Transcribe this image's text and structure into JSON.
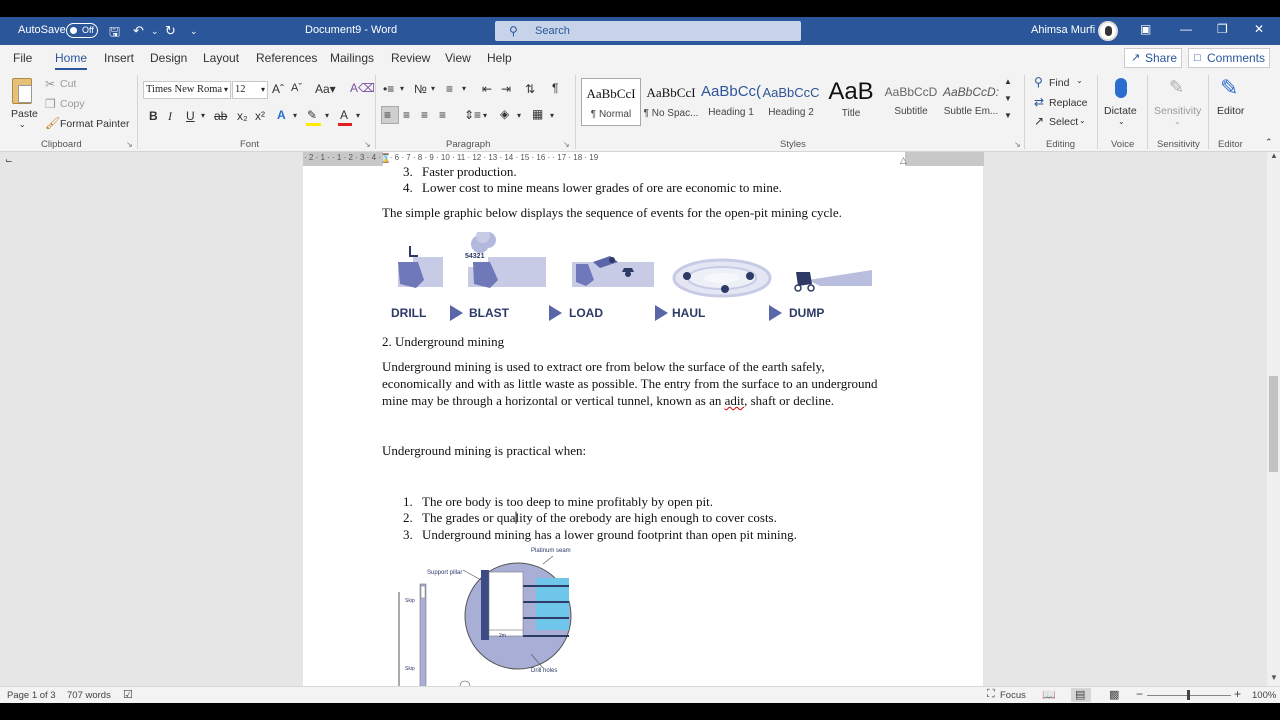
{
  "titlebar": {
    "autosave_label": "AutoSave",
    "autosave_state": "Off",
    "document_title": "Document9  -  Word",
    "search_placeholder": "Search",
    "user_name": "Ahimsa Murfi"
  },
  "tabs": [
    "File",
    "Home",
    "Insert",
    "Design",
    "Layout",
    "References",
    "Mailings",
    "Review",
    "View",
    "Help"
  ],
  "active_tab": "Home",
  "share_label": "Share",
  "comments_label": "Comments",
  "clipboard": {
    "paste": "Paste",
    "cut": "Cut",
    "copy": "Copy",
    "format_painter": "Format Painter",
    "group": "Clipboard"
  },
  "font": {
    "name": "Times New Roma",
    "size": "12",
    "group": "Font"
  },
  "paragraph_group": "Paragraph",
  "styles": {
    "items": [
      {
        "preview": "AaBbCcI",
        "name": "¶ Normal"
      },
      {
        "preview": "AaBbCcI",
        "name": "¶ No Spac..."
      },
      {
        "preview": "AaBbCc(",
        "name": "Heading 1"
      },
      {
        "preview": "AaBbCcC",
        "name": "Heading 2"
      },
      {
        "preview": "AaB",
        "name": "Title"
      },
      {
        "preview": "AaBbCcD",
        "name": "Subtitle"
      },
      {
        "preview": "AaBbCcD:",
        "name": "Subtle Em..."
      }
    ],
    "group": "Styles"
  },
  "editing": {
    "find": "Find",
    "replace": "Replace",
    "select": "Select",
    "group": "Editing"
  },
  "voice": {
    "dictate": "Dictate",
    "group": "Voice"
  },
  "sensitivity": {
    "label": "Sensitivity",
    "group": "Sensitivity"
  },
  "editor": {
    "label": "Editor",
    "group": "Editor"
  },
  "ruler_ticks": "· 2 · 1 · · 1 · 2 · 3 · 4 · 5 · 6 · 7 · 8 · 9 · 10 · 11 · 12 · 13 · 14 · 15 · 16 · · 17 · 18 · 19",
  "document": {
    "list_top": [
      {
        "num": "3.",
        "text": "Faster production."
      },
      {
        "num": "4.",
        "text": "Lower cost to mine means lower grades of ore are economic to mine."
      }
    ],
    "graphic_intro": "The simple graphic below displays the sequence of events for the open-pit mining cycle.",
    "cycle_steps": [
      "DRILL",
      "BLAST",
      "LOAD",
      "HAUL",
      "DUMP"
    ],
    "blast_countdown": "54321",
    "section_heading": "2. Underground mining",
    "para1_a": "Underground mining is used to extract ore from below the surface of the earth safely,",
    "para1_b": "economically and with as little waste as possible. The entry from the surface to an underground",
    "para1_c_pre": "mine may be through a horizontal or vertical tunnel, known as an ",
    "para1_c_err": "adit",
    "para1_c_post": ", shaft or decline.",
    "practical_when": "Underground mining is practical when:",
    "list_bottom": [
      {
        "num": "1.",
        "text": "The ore body is too deep to mine profitably by open pit."
      },
      {
        "num": "2.",
        "text": "The grades or quality of the orebody are high enough to cover costs."
      },
      {
        "num": "3.",
        "text": "Underground mining has a lower ground footprint than open pit mining."
      }
    ],
    "diagram_labels": {
      "platinum_seam": "Platinum seam",
      "support_pillar": "Support pillar",
      "skip1": "Skip",
      "skip2": "Skip",
      "width": "2m",
      "drill_holes": "Drill holes"
    }
  },
  "status": {
    "page": "Page 1 of 3",
    "words": "707 words",
    "focus": "Focus",
    "zoom": "100%"
  },
  "colors": {
    "accent": "#2b579a",
    "graphic_blue": "#2d3a66",
    "graphic_light": "#9fa6d1"
  }
}
